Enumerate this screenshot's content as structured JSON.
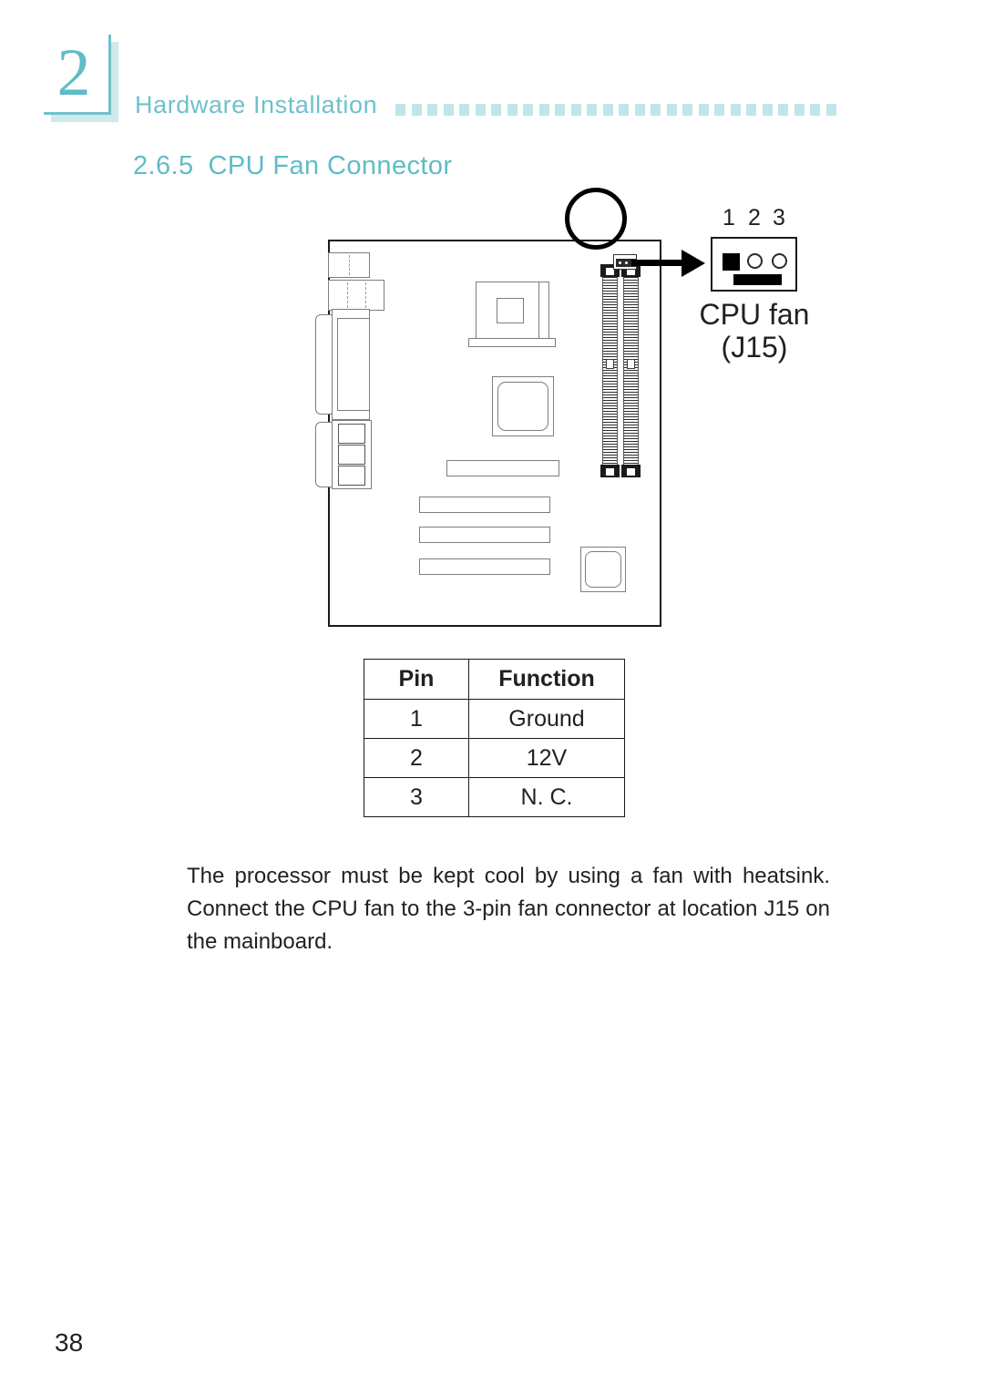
{
  "chapter": {
    "number": "2",
    "running_title": "Hardware Installation"
  },
  "section": {
    "number": "2.6.5",
    "title": "CPU Fan Connector"
  },
  "figure": {
    "connector_label_line1": "CPU fan",
    "connector_label_line2": "(J15)",
    "pin_numbers": [
      "1",
      "2",
      "3"
    ],
    "magnifier_name": "magnifier-circle",
    "callout_arrow_name": "callout-arrow"
  },
  "pin_table": {
    "headers": [
      "Pin",
      "Function"
    ],
    "rows": [
      {
        "pin": "1",
        "function": "Ground"
      },
      {
        "pin": "2",
        "function": "12V"
      },
      {
        "pin": "3",
        "function": "N. C."
      }
    ]
  },
  "body": {
    "paragraph": "The processor must be kept cool by using a fan with heatsink. Connect the CPU fan to the 3-pin fan connector at location J15 on the mainboard."
  },
  "footer": {
    "page_number": "38"
  },
  "colors": {
    "accent_teal": "#5fbcc7",
    "accent_light": "#bfe6ea",
    "text": "#231f20"
  }
}
